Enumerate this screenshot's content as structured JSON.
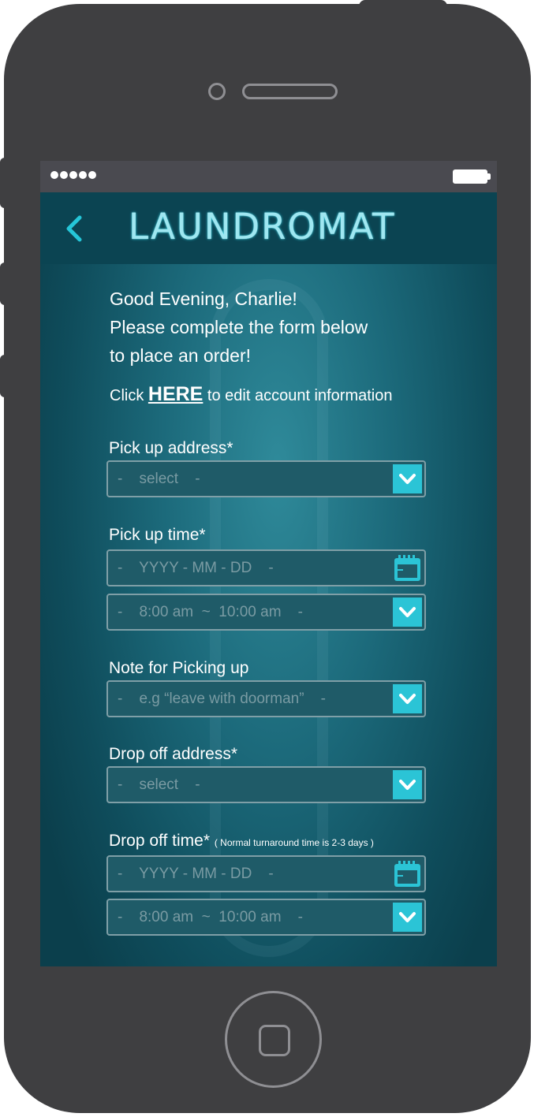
{
  "status_bar": {
    "signal_dots": 5,
    "battery": "full"
  },
  "header": {
    "back_label": "‹",
    "title": "LAUNDROMAT"
  },
  "greeting": {
    "line1": "Good Evening, Charlie!",
    "line2": "Please complete the form below",
    "line3": "to place an order!"
  },
  "edit_account": {
    "prefix": "Click ",
    "link": "HERE",
    "suffix": " to edit account information"
  },
  "form": {
    "pickup_address": {
      "label": "Pick up address*",
      "placeholder": "-    select    -"
    },
    "pickup_time": {
      "label": "Pick up time*",
      "date_placeholder": "-    YYYY - MM - DD    -",
      "time_placeholder": "-    8:00 am  ~  10:00 am    -"
    },
    "pickup_note": {
      "label": "Note for Picking up",
      "placeholder": "-    e.g “leave with doorman”    -"
    },
    "dropoff_address": {
      "label": "Drop off address*",
      "placeholder": "-    select    -"
    },
    "dropoff_time": {
      "label": "Drop off time*",
      "note": "( Normal turnaround time is 2-3 days )",
      "date_placeholder": "-    YYYY - MM - DD    -",
      "time_placeholder": "-    8:00 am  ~  10:00 am    -"
    }
  },
  "colors": {
    "accent": "#2bc4d6",
    "header_bg": "#0b4452",
    "phone_body": "#3f3f41"
  }
}
